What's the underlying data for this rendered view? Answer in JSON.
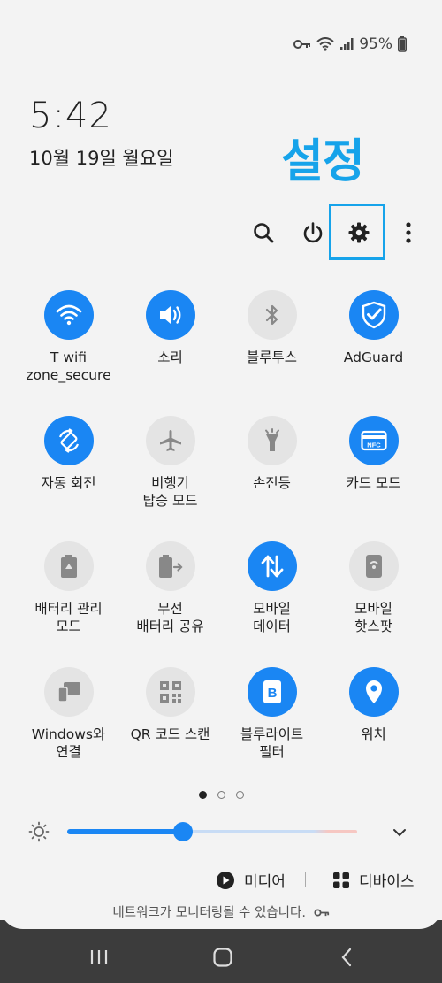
{
  "status_bar": {
    "battery_text": "95%"
  },
  "clock": {
    "time": "5:42",
    "date": "10월 19일 월요일"
  },
  "annotation": {
    "text": "설정",
    "color": "#16a3ea"
  },
  "toolbar": {
    "icons": [
      "search-icon",
      "power-icon",
      "gear-icon",
      "more-vert-icon"
    ]
  },
  "quick_tiles": [
    {
      "label": "T wifi\nzone_secure",
      "state": "on",
      "icon": "wifi-icon"
    },
    {
      "label": "소리",
      "state": "on",
      "icon": "sound-icon"
    },
    {
      "label": "블루투스",
      "state": "off",
      "icon": "bluetooth-icon"
    },
    {
      "label": "AdGuard",
      "state": "on",
      "icon": "shield-check-icon"
    },
    {
      "label": "자동 회전",
      "state": "on",
      "icon": "auto-rotate-icon"
    },
    {
      "label": "비행기\n탑승 모드",
      "state": "off",
      "icon": "airplane-icon"
    },
    {
      "label": "손전등",
      "state": "off",
      "icon": "flashlight-icon"
    },
    {
      "label": "카드 모드",
      "state": "on",
      "icon": "nfc-card-icon"
    },
    {
      "label": "배터리 관리\n모드",
      "state": "off",
      "icon": "battery-recycle-icon"
    },
    {
      "label": "무선\n배터리 공유",
      "state": "off",
      "icon": "battery-share-icon"
    },
    {
      "label": "모바일\n데이터",
      "state": "on",
      "icon": "mobile-data-icon"
    },
    {
      "label": "모바일\n핫스팟",
      "state": "off",
      "icon": "hotspot-icon"
    },
    {
      "label": "Windows와\n연결",
      "state": "off",
      "icon": "link-windows-icon"
    },
    {
      "label": "QR 코드 스캔",
      "state": "off",
      "icon": "qr-code-icon"
    },
    {
      "label": "블루라이트\n필터",
      "state": "on",
      "icon": "blue-light-filter-icon"
    },
    {
      "label": "위치",
      "state": "on",
      "icon": "location-icon"
    }
  ],
  "pager": {
    "pages": 3,
    "active_index": 0
  },
  "brightness": {
    "level_fraction": 0.4
  },
  "media_buttons": {
    "media_label": "미디어",
    "devices_label": "디바이스"
  },
  "notice": {
    "text": "네트워크가 모니터링될 수 있습니다."
  },
  "colors": {
    "accent": "#1a86f3",
    "tile_off": "#e4e4e4"
  }
}
